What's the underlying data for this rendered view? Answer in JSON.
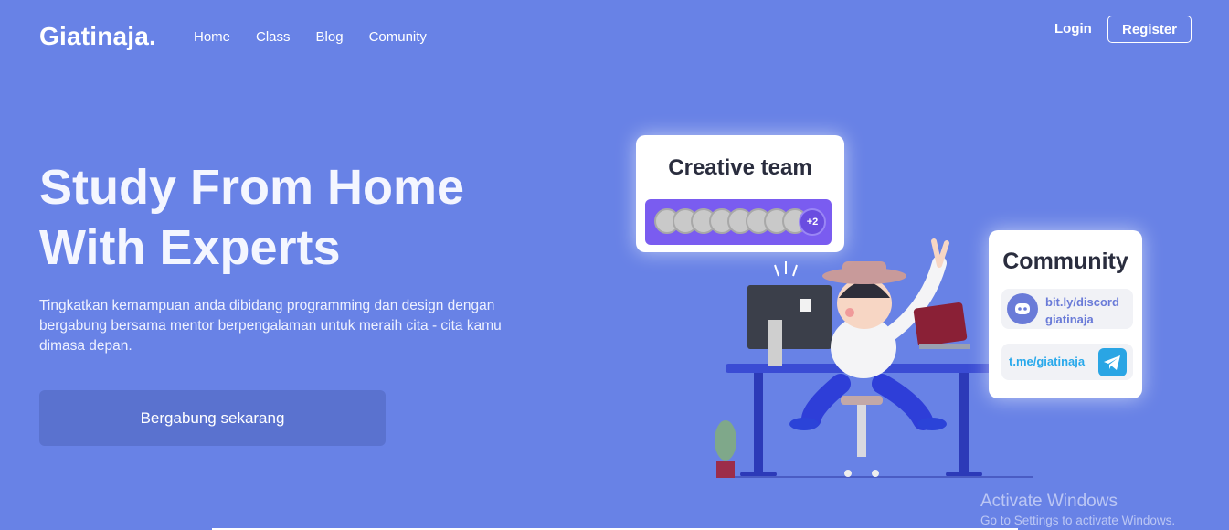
{
  "brand": {
    "logo": "Giatinaja."
  },
  "nav": {
    "items": [
      "Home",
      "Class",
      "Blog",
      "Comunity"
    ],
    "login": "Login",
    "register": "Register"
  },
  "hero": {
    "title_line1": "Study From Home",
    "title_line2": "With Experts",
    "description": "Tingkatkan kemampuan anda dibidang programming dan design dengan bergabung bersama mentor berpengalaman untuk meraih cita - cita kamu dimasa depan.",
    "cta": "Bergabung sekarang"
  },
  "team_card": {
    "title": "Creative team",
    "extra_members": "+2",
    "avatar_count": 8
  },
  "community_card": {
    "title": "Community",
    "discord_line1": "bit.ly/discord",
    "discord_line2": "giatinaja",
    "telegram": "t.me/giatinaja"
  },
  "watermark": {
    "line1": "Activate Windows",
    "line2": "Go to Settings to activate Windows."
  },
  "colors": {
    "background": "#6882e6",
    "cta": "#5a72cf",
    "team_strip": "#7a5cf0",
    "discord": "#6a7bd8",
    "telegram": "#29a9eb"
  },
  "icons": [
    "discord-icon",
    "telegram-icon",
    "person-at-desk-illustration"
  ]
}
